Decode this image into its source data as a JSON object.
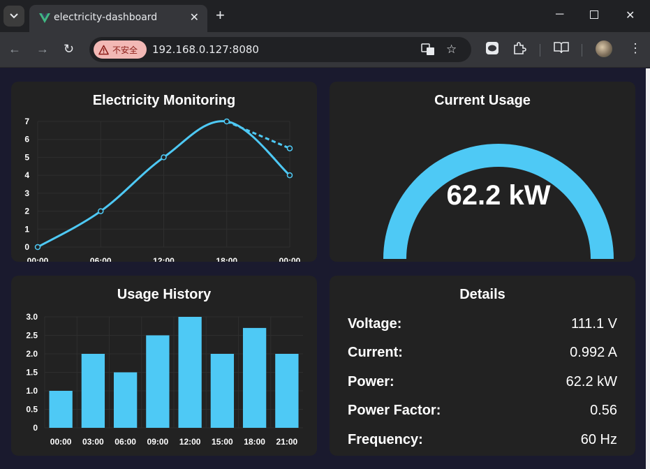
{
  "browser": {
    "tab_title": "electricity-dashboard",
    "security_label": "不安全",
    "url": "192.168.0.127:8080"
  },
  "cards": {
    "monitoring_title": "Electricity Monitoring",
    "current_title": "Current Usage",
    "history_title": "Usage History",
    "details_title": "Details"
  },
  "gauge": {
    "value_text": "62.2 kW",
    "fraction": 1.0,
    "color": "#4ec9f5"
  },
  "details": [
    {
      "label": "Voltage:",
      "value": "111.1 V"
    },
    {
      "label": "Current:",
      "value": "0.992 A"
    },
    {
      "label": "Power:",
      "value": "62.2 kW"
    },
    {
      "label": "Power Factor:",
      "value": "0.56"
    },
    {
      "label": "Frequency:",
      "value": "60 Hz"
    }
  ],
  "chart_data": [
    {
      "type": "line",
      "title": "Electricity Monitoring",
      "categories": [
        "00:00",
        "06:00",
        "12:00",
        "18:00",
        "00:00"
      ],
      "series": [
        {
          "values": [
            0,
            2,
            5,
            7,
            4
          ],
          "style": "solid"
        },
        {
          "values": [
            null,
            null,
            null,
            7,
            5.5
          ],
          "style": "dashed"
        }
      ],
      "ylim": [
        0,
        7
      ],
      "yticks": [
        0,
        1,
        2,
        3,
        4,
        5,
        6,
        7
      ],
      "grid": true,
      "color": "#4ec9f5"
    },
    {
      "type": "bar",
      "title": "Usage History",
      "categories": [
        "00:00",
        "03:00",
        "06:00",
        "09:00",
        "12:00",
        "15:00",
        "18:00",
        "21:00"
      ],
      "values": [
        1.0,
        2.0,
        1.5,
        2.5,
        3.0,
        2.0,
        2.7,
        2.0
      ],
      "ylim": [
        0,
        3.0
      ],
      "yticks": [
        "0",
        "0.5",
        "1.0",
        "1.5",
        "2.0",
        "2.5",
        "3.0"
      ],
      "grid": true,
      "color": "#4ec9f5"
    }
  ]
}
